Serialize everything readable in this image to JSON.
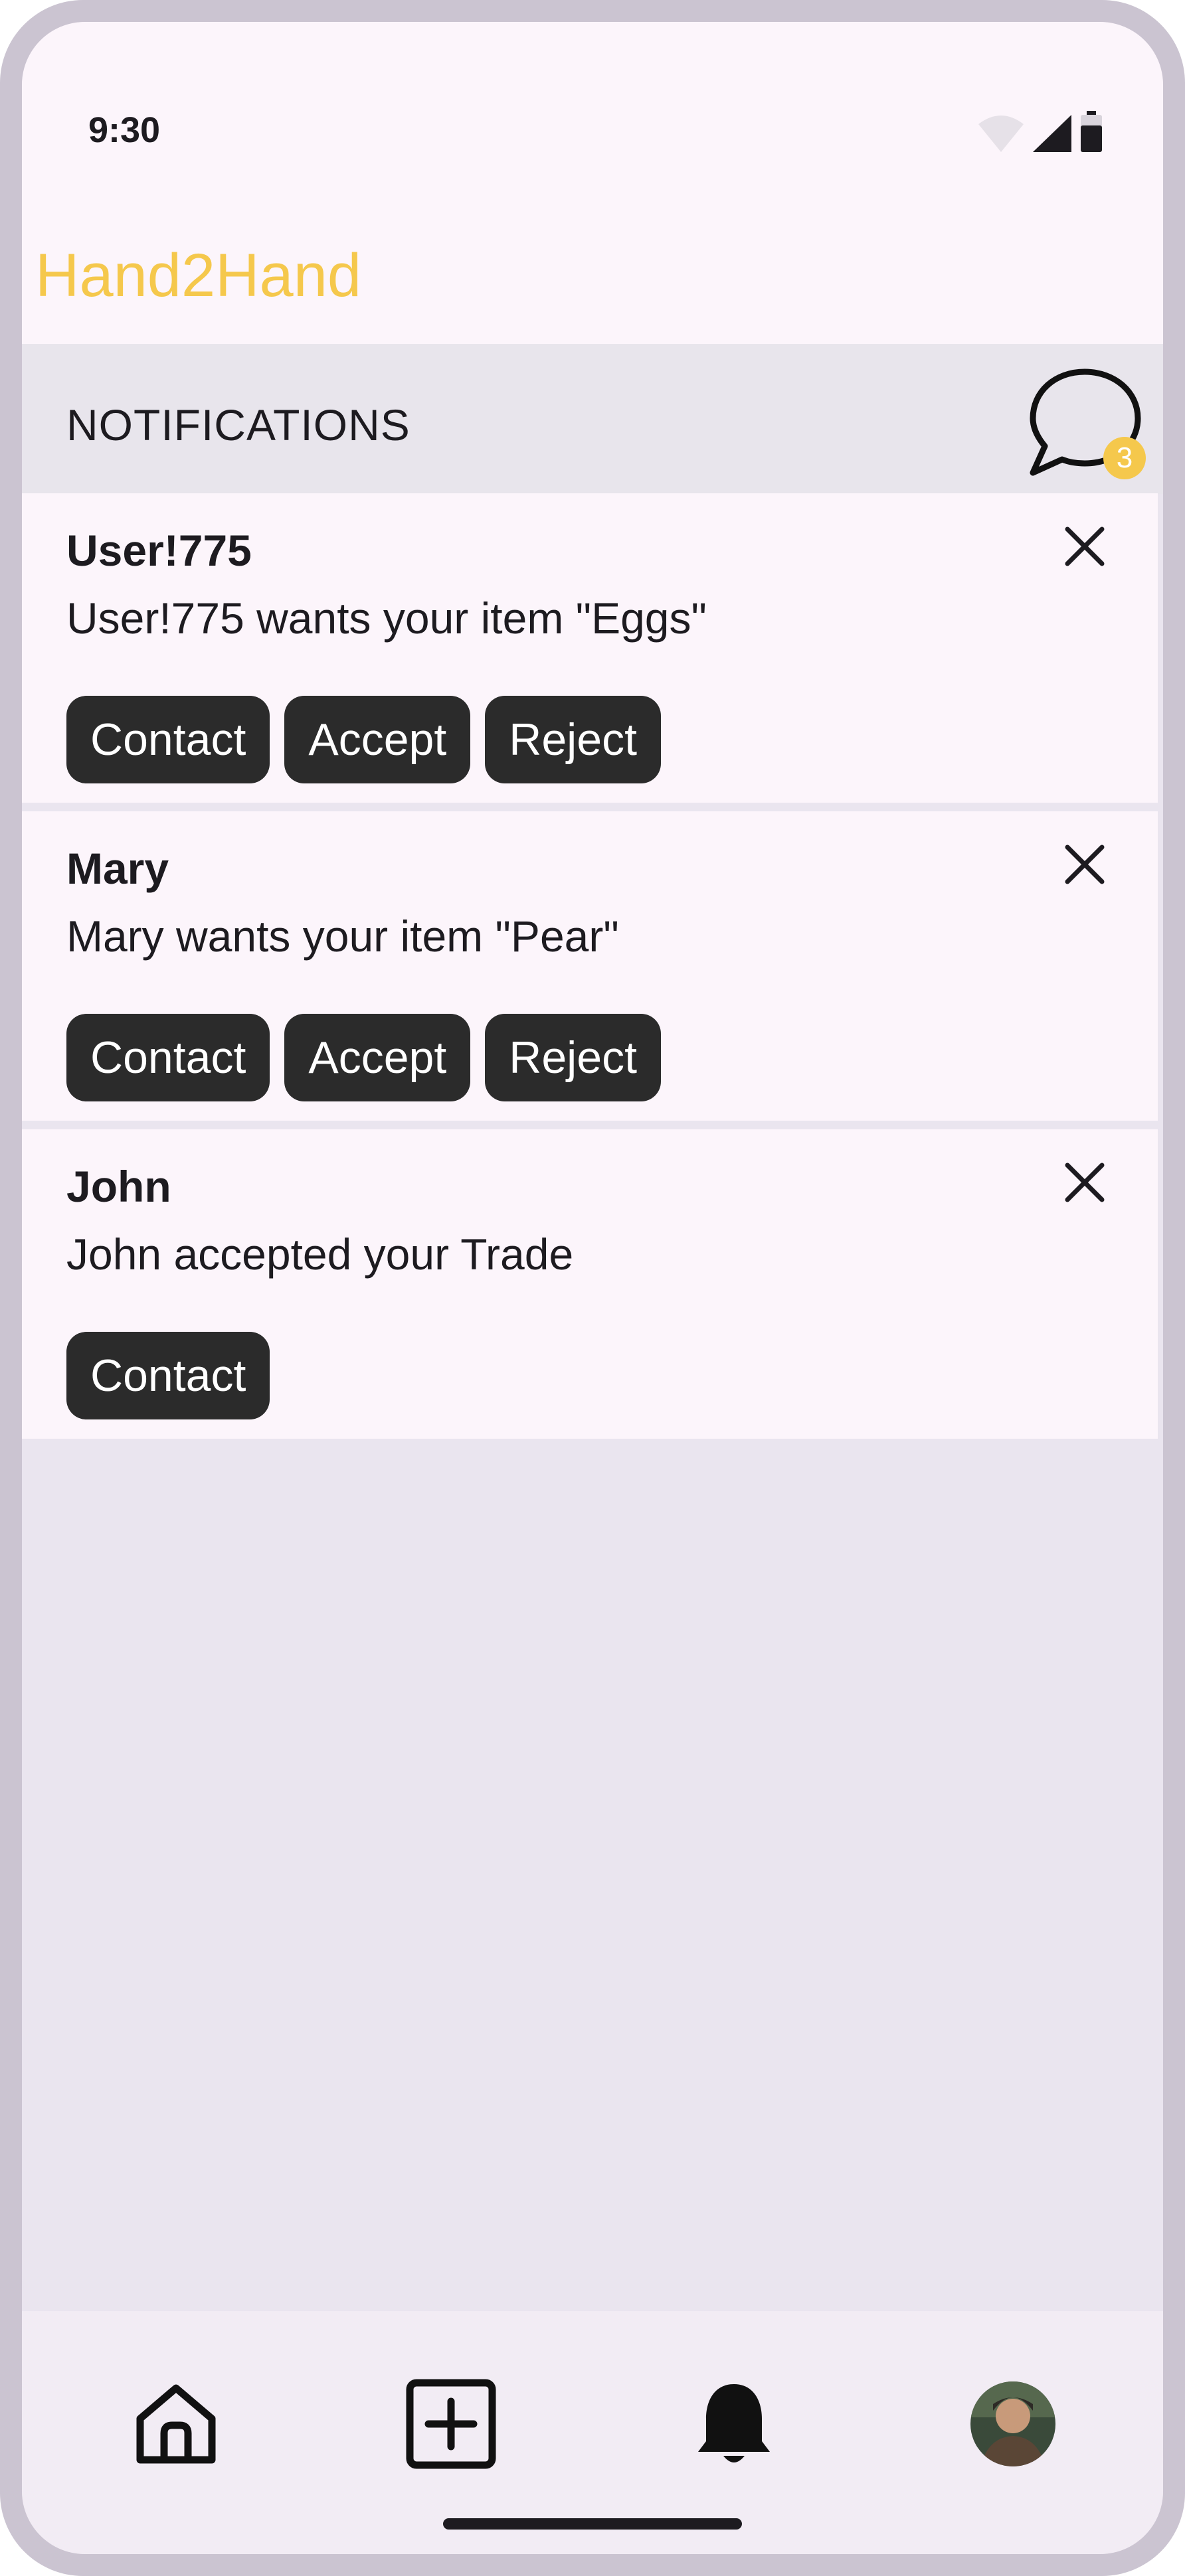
{
  "status_bar": {
    "time": "9:30"
  },
  "app": {
    "title": "Hand2Hand",
    "brand_color": "#f5c84c"
  },
  "notifications_header": {
    "title": "NOTIFICATIONS",
    "chat_badge": "3"
  },
  "notifications": [
    {
      "name": "User!775",
      "message": "User!775 wants your item \"Eggs\"",
      "actions": {
        "contact": "Contact",
        "accept": "Accept",
        "reject": "Reject"
      }
    },
    {
      "name": "Mary",
      "message": "Mary wants your item \"Pear\"",
      "actions": {
        "contact": "Contact",
        "accept": "Accept",
        "reject": "Reject"
      }
    },
    {
      "name": "John",
      "message": "John accepted your Trade",
      "actions": {
        "contact": "Contact"
      }
    }
  ],
  "bottom_nav": {
    "items": [
      {
        "icon": "home-icon"
      },
      {
        "icon": "add-square-icon"
      },
      {
        "icon": "bell-icon",
        "active": true
      },
      {
        "icon": "avatar"
      }
    ]
  }
}
